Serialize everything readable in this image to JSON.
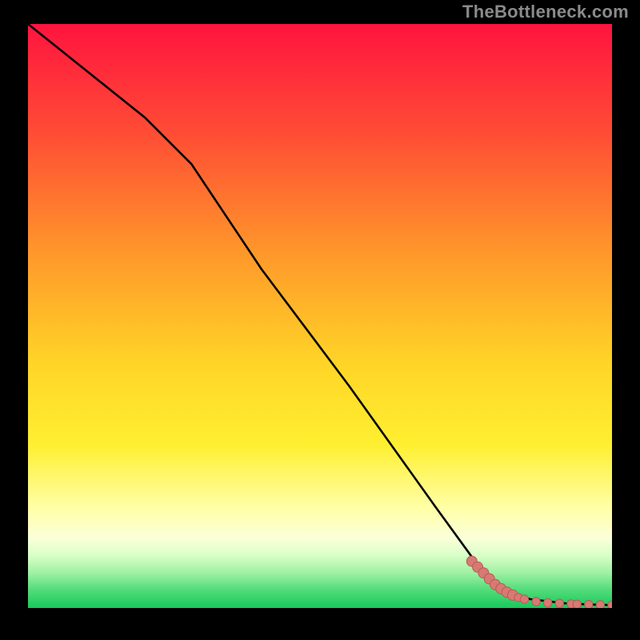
{
  "watermark": "TheBottleneck.com",
  "colors": {
    "gradient_top": "#ff143f",
    "gradient_mid_upper": "#ff8a2a",
    "gradient_mid": "#ffe625",
    "gradient_pale_yellow": "#ffffb2",
    "gradient_green_light": "#9df09f",
    "gradient_green": "#1fcf62",
    "line": "#000000",
    "marker_fill": "#d77a74",
    "marker_stroke": "#b85a54",
    "background": "#000000"
  },
  "chart_data": {
    "type": "line",
    "title": "",
    "xlabel": "",
    "ylabel": "",
    "xlim": [
      0,
      100
    ],
    "ylim": [
      0,
      100
    ],
    "series": [
      {
        "name": "black-curve",
        "x": [
          0,
          10,
          20,
          28,
          40,
          55,
          70,
          78,
          82,
          86,
          92,
          96,
          100
        ],
        "y": [
          100,
          92,
          84,
          76,
          58,
          38,
          17,
          6,
          3,
          1.5,
          0.8,
          0.6,
          0.5
        ]
      },
      {
        "name": "highlighted-points",
        "x": [
          76,
          77,
          78,
          79,
          80,
          81,
          82,
          83,
          84,
          85,
          87,
          89,
          91,
          93,
          94,
          96,
          98,
          100
        ],
        "y": [
          8,
          7,
          6,
          5,
          4,
          3.3,
          2.7,
          2.2,
          1.8,
          1.5,
          1.1,
          0.9,
          0.8,
          0.7,
          0.65,
          0.6,
          0.55,
          0.5
        ]
      }
    ],
    "annotations": []
  }
}
